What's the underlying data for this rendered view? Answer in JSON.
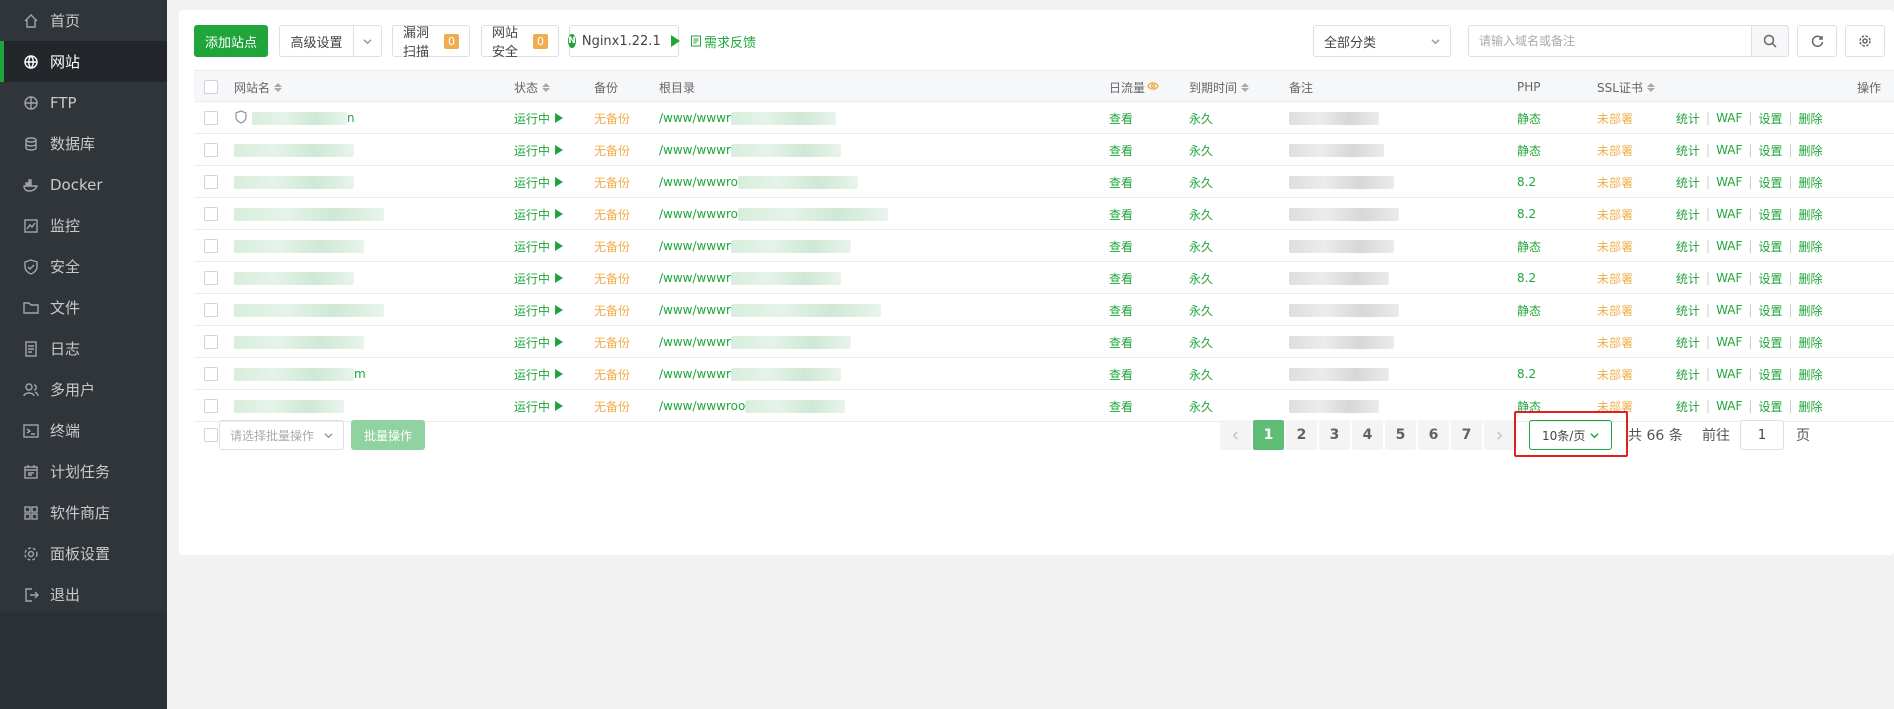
{
  "sidebar": {
    "items": [
      {
        "label": "首页",
        "icon": "home-icon",
        "active": false
      },
      {
        "label": "网站",
        "icon": "globe-icon",
        "active": true
      },
      {
        "label": "FTP",
        "icon": "ftp-icon",
        "active": false
      },
      {
        "label": "数据库",
        "icon": "database-icon",
        "active": false
      },
      {
        "label": "Docker",
        "icon": "docker-icon",
        "active": false
      },
      {
        "label": "监控",
        "icon": "monitor-icon",
        "active": false
      },
      {
        "label": "安全",
        "icon": "shield-icon",
        "active": false
      },
      {
        "label": "文件",
        "icon": "folder-icon",
        "active": false
      },
      {
        "label": "日志",
        "icon": "log-icon",
        "active": false
      },
      {
        "label": "多用户",
        "icon": "users-icon",
        "active": false
      },
      {
        "label": "终端",
        "icon": "terminal-icon",
        "active": false
      },
      {
        "label": "计划任务",
        "icon": "calendar-icon",
        "active": false
      },
      {
        "label": "软件商店",
        "icon": "apps-icon",
        "active": false
      },
      {
        "label": "面板设置",
        "icon": "gear-icon",
        "active": false
      },
      {
        "label": "退出",
        "icon": "logout-icon",
        "active": false
      }
    ]
  },
  "toolbar": {
    "add_site": "添加站点",
    "advanced": "高级设置",
    "vuln_scan": "漏洞扫描",
    "vuln_scan_count": "0",
    "site_security": "网站安全",
    "site_security_count": "0",
    "nginx_logo_letter": "N",
    "nginx": "Nginx1.22.1",
    "feedback": "需求反馈",
    "category": "全部分类",
    "search_placeholder": "请输入域名或备注"
  },
  "table": {
    "headers": {
      "name": "网站名",
      "status": "状态",
      "backup": "备份",
      "root": "根目录",
      "traffic": "日流量",
      "expire": "到期时间",
      "remark": "备注",
      "php": "PHP",
      "ssl": "SSL证书",
      "ops": "操作"
    },
    "rows": [
      {
        "name_suffix": "n",
        "status": "运行中",
        "backup": "无备份",
        "root": "/www/wwwr",
        "traffic": "查看",
        "expire": "永久",
        "php": "静态",
        "ssl": "未部署"
      },
      {
        "name_suffix": "",
        "status": "运行中",
        "backup": "无备份",
        "root": "/www/wwwr",
        "traffic": "查看",
        "expire": "永久",
        "php": "静态",
        "ssl": "未部署"
      },
      {
        "name_suffix": "",
        "status": "运行中",
        "backup": "无备份",
        "root": "/www/wwwro",
        "traffic": "查看",
        "expire": "永久",
        "php": "8.2",
        "ssl": "未部署"
      },
      {
        "name_suffix": "",
        "status": "运行中",
        "backup": "无备份",
        "root": "/www/wwwro",
        "traffic": "查看",
        "expire": "永久",
        "php": "8.2",
        "ssl": "未部署"
      },
      {
        "name_suffix": "",
        "status": "运行中",
        "backup": "无备份",
        "root": "/www/wwwr",
        "traffic": "查看",
        "expire": "永久",
        "php": "静态",
        "ssl": "未部署"
      },
      {
        "name_suffix": "",
        "status": "运行中",
        "backup": "无备份",
        "root": "/www/wwwr",
        "traffic": "查看",
        "expire": "永久",
        "php": "8.2",
        "ssl": "未部署"
      },
      {
        "name_suffix": "",
        "status": "运行中",
        "backup": "无备份",
        "root": "/www/wwwr",
        "traffic": "查看",
        "expire": "永久",
        "php": "静态",
        "ssl": "未部署"
      },
      {
        "name_suffix": "",
        "status": "运行中",
        "backup": "无备份",
        "root": "/www/wwwr",
        "traffic": "查看",
        "expire": "永久",
        "php": "",
        "ssl": "未部署"
      },
      {
        "name_suffix": "m",
        "status": "运行中",
        "backup": "无备份",
        "root": "/www/wwwr",
        "traffic": "查看",
        "expire": "永久",
        "php": "8.2",
        "ssl": "未部署"
      },
      {
        "name_suffix": "",
        "status": "运行中",
        "backup": "无备份",
        "root": "/www/wwwroo",
        "traffic": "查看",
        "expire": "永久",
        "php": "静态",
        "ssl": "未部署"
      }
    ],
    "op_labels": [
      "统计",
      "WAF",
      "设置",
      "删除"
    ]
  },
  "footer": {
    "batch_placeholder": "请选择批量操作",
    "batch_button": "批量操作",
    "pages": [
      "1",
      "2",
      "3",
      "4",
      "5",
      "6",
      "7"
    ],
    "current_page": "1",
    "per_page": "10条/页",
    "total": "共 66 条",
    "goto_label": "前往",
    "goto_value": "1",
    "page_unit": "页"
  },
  "colors": {
    "accent": "#20a53a",
    "warning": "#f0ad4e",
    "highlight_box": "#e02020",
    "sidebar_bg": "#30353a"
  }
}
